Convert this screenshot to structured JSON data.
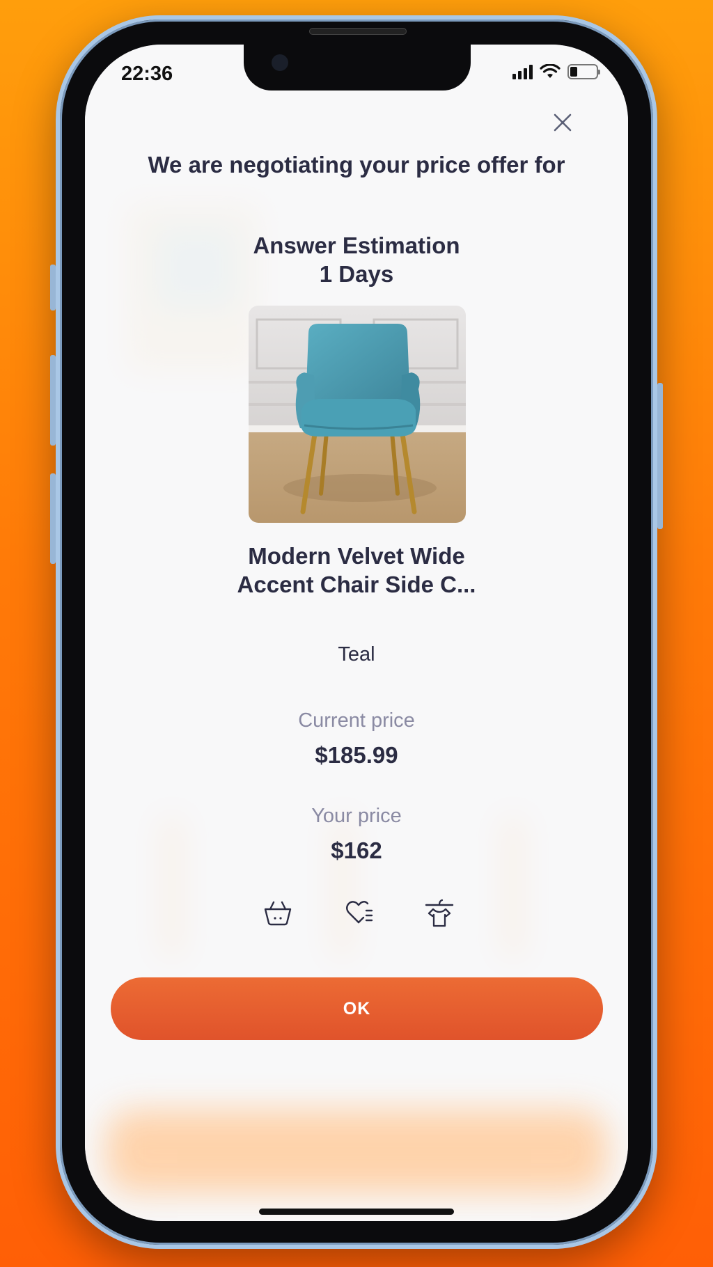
{
  "status_bar": {
    "time": "22:36"
  },
  "modal": {
    "title": "We are negotiating your price offer for",
    "estimation": "Answer Estimation 1 Days",
    "product_name": "Modern Velvet Wide Accent Chair Side C...",
    "color": "Teal",
    "current_price_label": "Current price",
    "current_price": "$185.99",
    "your_price_label": "Your price",
    "your_price": "$162",
    "ok_label": "OK",
    "action_icons": [
      "basket-icon",
      "heart-list-icon",
      "clothes-hanger-icon"
    ]
  },
  "colors": {
    "accent": "#e35a2d",
    "text_dark": "#2b2c43",
    "text_muted": "#8a8aa3",
    "background_orange": "#ff7a08",
    "chair_teal": "#4a9bb0"
  }
}
